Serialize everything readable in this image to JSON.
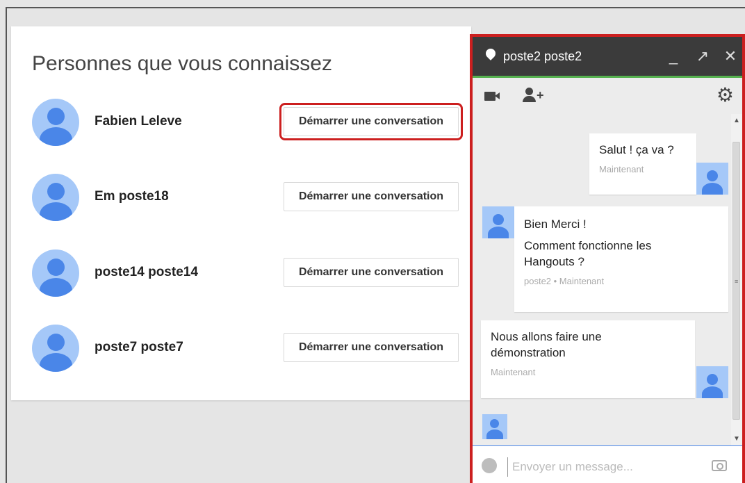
{
  "people": {
    "title": "Personnes que vous connaissez",
    "items": [
      {
        "name": "Fabien Leleve",
        "button": "Démarrer une conversation"
      },
      {
        "name": "Em poste18",
        "button": "Démarrer une conversation"
      },
      {
        "name": "poste14 poste14",
        "button": "Démarrer une conversation"
      },
      {
        "name": "poste7 poste7",
        "button": "Démarrer une conversation"
      }
    ]
  },
  "chat": {
    "title": "poste2 poste2",
    "minimize": "_",
    "popout": "↗",
    "close": "✕",
    "messages": [
      {
        "lines": [
          "Salut ! ça va ?"
        ],
        "meta": "Maintenant"
      },
      {
        "lines": [
          "Bien Merci !",
          "Comment fonctionne les",
          "Hangouts ?"
        ],
        "meta": "poste2 • Maintenant"
      },
      {
        "lines": [
          "Nous allons faire une",
          "démonstration"
        ],
        "meta": "Maintenant"
      }
    ],
    "input_placeholder": "Envoyer un message..."
  },
  "colors": {
    "accent_red": "#cc1f1f",
    "titlebar": "#3b3b3b",
    "online_green": "#55b14e",
    "avatar_blue": "#4a86e8"
  }
}
